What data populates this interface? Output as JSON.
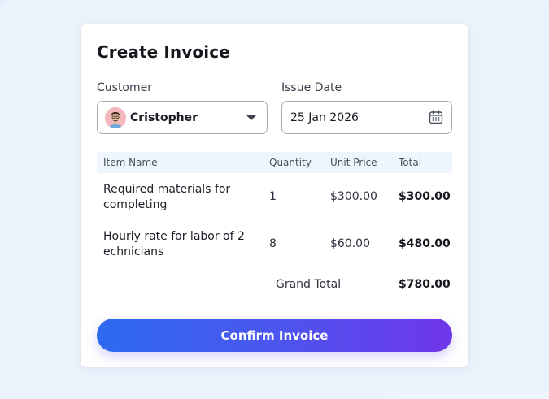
{
  "card": {
    "title": "Create Invoice"
  },
  "customer": {
    "label": "Customer",
    "selected": "Cristopher",
    "avatar_icon": "person-avatar",
    "dropdown_icon": "chevron-down-icon"
  },
  "issue_date": {
    "label": "Issue Date",
    "value": "25 Jan 2026",
    "icon": "calendar-icon"
  },
  "table": {
    "headers": [
      "Item Name",
      "Quantity",
      "Unit Price",
      "Total"
    ],
    "rows": [
      {
        "name": "Required materials for completing",
        "quantity": "1",
        "unit_price": "$300.00",
        "total": "$300.00"
      },
      {
        "name": "Hourly rate for labor of 2 echnicians",
        "quantity": "8",
        "unit_price": "$60.00",
        "total": "$480.00"
      }
    ],
    "grand_total_label": "Grand Total",
    "grand_total_value": "$780.00"
  },
  "actions": {
    "confirm_label": "Confirm Invoice"
  },
  "colors": {
    "accent_start": "#2d6af0",
    "accent_end": "#7036ea",
    "header_bg": "#eef5fd",
    "page_bg": "#eaf2fb"
  }
}
